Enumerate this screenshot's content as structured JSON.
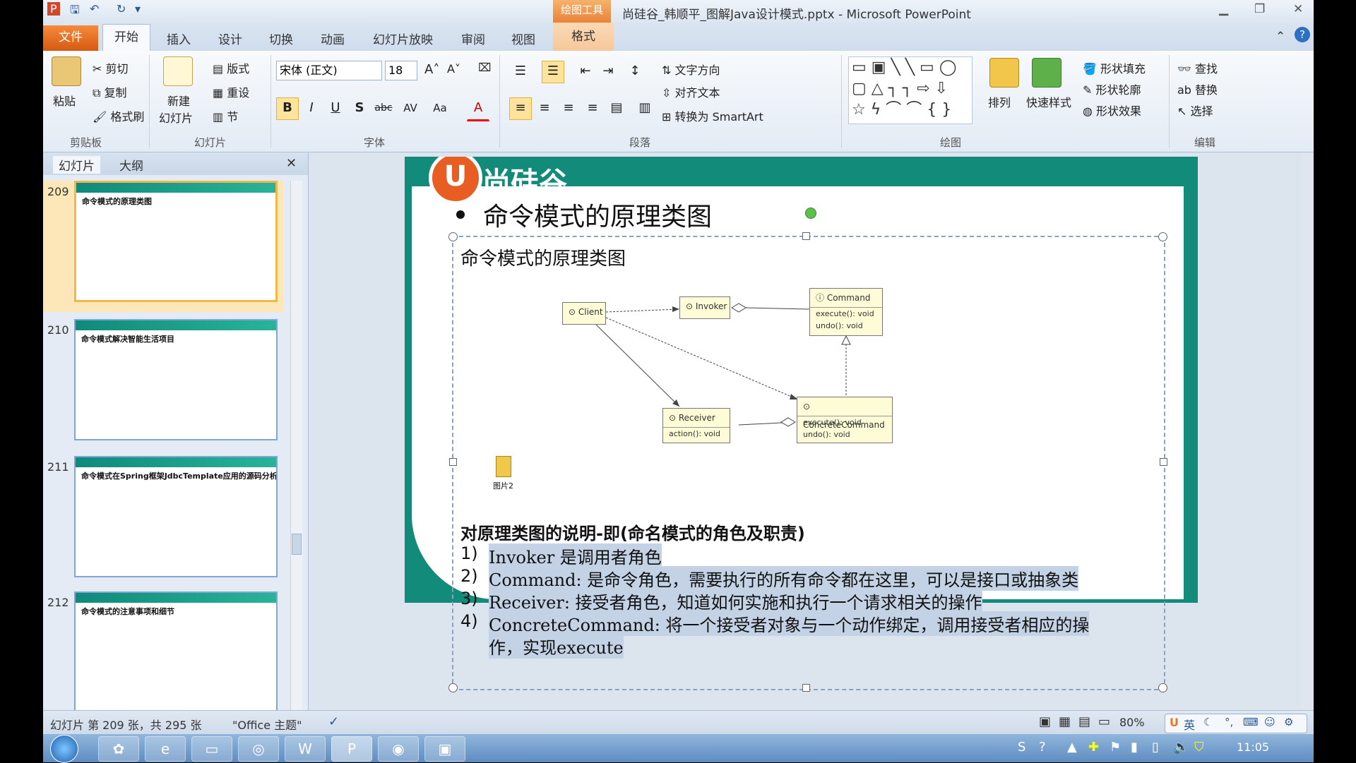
{
  "window": {
    "title": "尚硅谷_韩顺平_图解Java设计模式.pptx - Microsoft PowerPoint",
    "context_tool": "绘图工具"
  },
  "tabs": {
    "file": "文件",
    "home": "开始",
    "insert": "插入",
    "design": "设计",
    "transitions": "切换",
    "animations": "动画",
    "slideshow": "幻灯片放映",
    "review": "审阅",
    "view": "视图",
    "format": "格式"
  },
  "ribbon": {
    "clipboard": {
      "paste": "粘贴",
      "cut": "剪切",
      "copy": "复制",
      "format_painter": "格式刷",
      "group": "剪贴板"
    },
    "slides": {
      "new_slide": "新建",
      "new_slide2": "幻灯片",
      "layout": "版式",
      "reset": "重设",
      "section": "节",
      "group": "幻灯片"
    },
    "font": {
      "family": "宋体 (正文)",
      "size": "18",
      "group": "字体"
    },
    "paragraph": {
      "text_direction": "文字方向",
      "align_text": "对齐文本",
      "smartart": "转换为 SmartArt",
      "group": "段落"
    },
    "drawing": {
      "arrange": "排列",
      "quick_styles": "快速样式",
      "fill": "形状填充",
      "outline": "形状轮廓",
      "effects": "形状效果",
      "group": "绘图"
    },
    "editing": {
      "find": "查找",
      "replace": "替换",
      "select": "选择",
      "group": "编辑"
    }
  },
  "pane": {
    "tab_slides": "幻灯片",
    "tab_outline": "大纲",
    "slides": [
      {
        "num": "209",
        "title": "命令模式的原理类图"
      },
      {
        "num": "210",
        "title": "命令模式解决智能生活项目"
      },
      {
        "num": "211",
        "title": "命令模式在Spring框架JdbcTemplate应用的源码分析"
      },
      {
        "num": "212",
        "title": "命令模式的注意事项和细节"
      }
    ]
  },
  "slide": {
    "brand": "尚硅谷",
    "title": "命令模式的原理类图",
    "subtitle": "命令模式的原理类图",
    "image_caption": "图片2",
    "desc_heading": "对原理类图的说明-即(命名模式的角色及职责)",
    "items": [
      {
        "num": "1)",
        "text": "Invoker 是调用者角色"
      },
      {
        "num": "2)",
        "text": "Command: 是命令角色，需要执行的所有命令都在这里，可以是接口或抽象类"
      },
      {
        "num": "3)",
        "text": "Receiver: 接受者角色，知道如何实施和执行一个请求相关的操作"
      },
      {
        "num": "4)",
        "text": "ConcreteCommand: 将一个接受者对象与一个动作绑定，调用接受者相应的操"
      },
      {
        "num": "",
        "text": "作，实现execute"
      }
    ],
    "uml": {
      "client": "Client",
      "invoker": "Invoker",
      "command": "Command",
      "command_m1": "execute(): void",
      "command_m2": "undo(): void",
      "receiver": "Receiver",
      "receiver_m1": "action(): void",
      "concrete": "ConcreteCommand",
      "concrete_m1": "execute(): void",
      "concrete_m2": "undo(): void"
    }
  },
  "status": {
    "slide_info": "幻灯片 第 209 张，共 295 张",
    "theme": "\"Office 主题\"",
    "zoom": "80%",
    "ime": "英"
  },
  "taskbar": {
    "clock": "11:05"
  }
}
